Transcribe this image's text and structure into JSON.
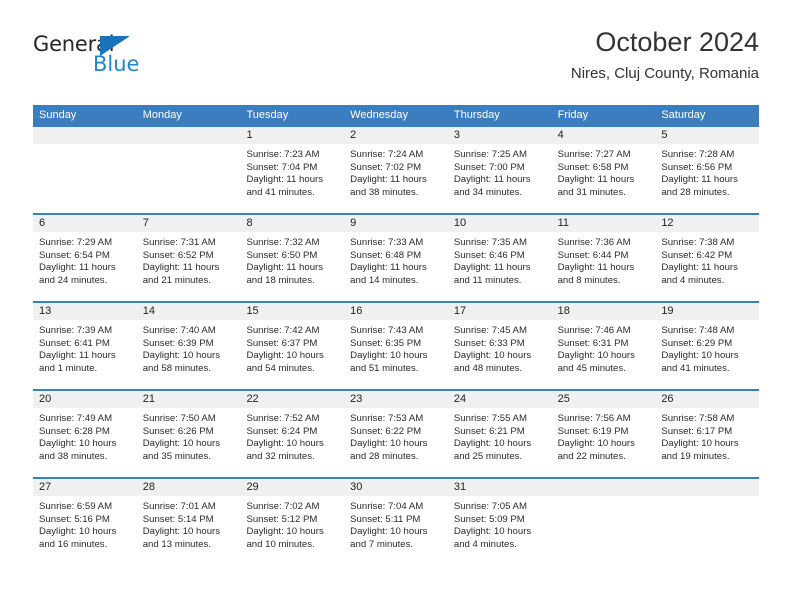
{
  "brand": {
    "name_top": "General",
    "name_bottom": "Blue",
    "triangle_color": "#1b74bb",
    "blue_color": "#2585c9"
  },
  "header": {
    "title": "October 2024",
    "subtitle": "Nires, Cluj County, Romania"
  },
  "theme": {
    "header_band": "#3b7ebf",
    "daynum_band": "#f0f0f0",
    "text": "#2b2b2b"
  },
  "weekday_labels": [
    "Sunday",
    "Monday",
    "Tuesday",
    "Wednesday",
    "Thursday",
    "Friday",
    "Saturday"
  ],
  "weeks": [
    [
      {
        "day": "",
        "sunrise": "",
        "sunset": "",
        "daylight_line1": "",
        "daylight_line2": ""
      },
      {
        "day": "",
        "sunrise": "",
        "sunset": "",
        "daylight_line1": "",
        "daylight_line2": ""
      },
      {
        "day": "1",
        "sunrise": "Sunrise: 7:23 AM",
        "sunset": "Sunset: 7:04 PM",
        "daylight_line1": "Daylight: 11 hours",
        "daylight_line2": "and 41 minutes."
      },
      {
        "day": "2",
        "sunrise": "Sunrise: 7:24 AM",
        "sunset": "Sunset: 7:02 PM",
        "daylight_line1": "Daylight: 11 hours",
        "daylight_line2": "and 38 minutes."
      },
      {
        "day": "3",
        "sunrise": "Sunrise: 7:25 AM",
        "sunset": "Sunset: 7:00 PM",
        "daylight_line1": "Daylight: 11 hours",
        "daylight_line2": "and 34 minutes."
      },
      {
        "day": "4",
        "sunrise": "Sunrise: 7:27 AM",
        "sunset": "Sunset: 6:58 PM",
        "daylight_line1": "Daylight: 11 hours",
        "daylight_line2": "and 31 minutes."
      },
      {
        "day": "5",
        "sunrise": "Sunrise: 7:28 AM",
        "sunset": "Sunset: 6:56 PM",
        "daylight_line1": "Daylight: 11 hours",
        "daylight_line2": "and 28 minutes."
      }
    ],
    [
      {
        "day": "6",
        "sunrise": "Sunrise: 7:29 AM",
        "sunset": "Sunset: 6:54 PM",
        "daylight_line1": "Daylight: 11 hours",
        "daylight_line2": "and 24 minutes."
      },
      {
        "day": "7",
        "sunrise": "Sunrise: 7:31 AM",
        "sunset": "Sunset: 6:52 PM",
        "daylight_line1": "Daylight: 11 hours",
        "daylight_line2": "and 21 minutes."
      },
      {
        "day": "8",
        "sunrise": "Sunrise: 7:32 AM",
        "sunset": "Sunset: 6:50 PM",
        "daylight_line1": "Daylight: 11 hours",
        "daylight_line2": "and 18 minutes."
      },
      {
        "day": "9",
        "sunrise": "Sunrise: 7:33 AM",
        "sunset": "Sunset: 6:48 PM",
        "daylight_line1": "Daylight: 11 hours",
        "daylight_line2": "and 14 minutes."
      },
      {
        "day": "10",
        "sunrise": "Sunrise: 7:35 AM",
        "sunset": "Sunset: 6:46 PM",
        "daylight_line1": "Daylight: 11 hours",
        "daylight_line2": "and 11 minutes."
      },
      {
        "day": "11",
        "sunrise": "Sunrise: 7:36 AM",
        "sunset": "Sunset: 6:44 PM",
        "daylight_line1": "Daylight: 11 hours",
        "daylight_line2": "and 8 minutes."
      },
      {
        "day": "12",
        "sunrise": "Sunrise: 7:38 AM",
        "sunset": "Sunset: 6:42 PM",
        "daylight_line1": "Daylight: 11 hours",
        "daylight_line2": "and 4 minutes."
      }
    ],
    [
      {
        "day": "13",
        "sunrise": "Sunrise: 7:39 AM",
        "sunset": "Sunset: 6:41 PM",
        "daylight_line1": "Daylight: 11 hours",
        "daylight_line2": "and 1 minute."
      },
      {
        "day": "14",
        "sunrise": "Sunrise: 7:40 AM",
        "sunset": "Sunset: 6:39 PM",
        "daylight_line1": "Daylight: 10 hours",
        "daylight_line2": "and 58 minutes."
      },
      {
        "day": "15",
        "sunrise": "Sunrise: 7:42 AM",
        "sunset": "Sunset: 6:37 PM",
        "daylight_line1": "Daylight: 10 hours",
        "daylight_line2": "and 54 minutes."
      },
      {
        "day": "16",
        "sunrise": "Sunrise: 7:43 AM",
        "sunset": "Sunset: 6:35 PM",
        "daylight_line1": "Daylight: 10 hours",
        "daylight_line2": "and 51 minutes."
      },
      {
        "day": "17",
        "sunrise": "Sunrise: 7:45 AM",
        "sunset": "Sunset: 6:33 PM",
        "daylight_line1": "Daylight: 10 hours",
        "daylight_line2": "and 48 minutes."
      },
      {
        "day": "18",
        "sunrise": "Sunrise: 7:46 AM",
        "sunset": "Sunset: 6:31 PM",
        "daylight_line1": "Daylight: 10 hours",
        "daylight_line2": "and 45 minutes."
      },
      {
        "day": "19",
        "sunrise": "Sunrise: 7:48 AM",
        "sunset": "Sunset: 6:29 PM",
        "daylight_line1": "Daylight: 10 hours",
        "daylight_line2": "and 41 minutes."
      }
    ],
    [
      {
        "day": "20",
        "sunrise": "Sunrise: 7:49 AM",
        "sunset": "Sunset: 6:28 PM",
        "daylight_line1": "Daylight: 10 hours",
        "daylight_line2": "and 38 minutes."
      },
      {
        "day": "21",
        "sunrise": "Sunrise: 7:50 AM",
        "sunset": "Sunset: 6:26 PM",
        "daylight_line1": "Daylight: 10 hours",
        "daylight_line2": "and 35 minutes."
      },
      {
        "day": "22",
        "sunrise": "Sunrise: 7:52 AM",
        "sunset": "Sunset: 6:24 PM",
        "daylight_line1": "Daylight: 10 hours",
        "daylight_line2": "and 32 minutes."
      },
      {
        "day": "23",
        "sunrise": "Sunrise: 7:53 AM",
        "sunset": "Sunset: 6:22 PM",
        "daylight_line1": "Daylight: 10 hours",
        "daylight_line2": "and 28 minutes."
      },
      {
        "day": "24",
        "sunrise": "Sunrise: 7:55 AM",
        "sunset": "Sunset: 6:21 PM",
        "daylight_line1": "Daylight: 10 hours",
        "daylight_line2": "and 25 minutes."
      },
      {
        "day": "25",
        "sunrise": "Sunrise: 7:56 AM",
        "sunset": "Sunset: 6:19 PM",
        "daylight_line1": "Daylight: 10 hours",
        "daylight_line2": "and 22 minutes."
      },
      {
        "day": "26",
        "sunrise": "Sunrise: 7:58 AM",
        "sunset": "Sunset: 6:17 PM",
        "daylight_line1": "Daylight: 10 hours",
        "daylight_line2": "and 19 minutes."
      }
    ],
    [
      {
        "day": "27",
        "sunrise": "Sunrise: 6:59 AM",
        "sunset": "Sunset: 5:16 PM",
        "daylight_line1": "Daylight: 10 hours",
        "daylight_line2": "and 16 minutes."
      },
      {
        "day": "28",
        "sunrise": "Sunrise: 7:01 AM",
        "sunset": "Sunset: 5:14 PM",
        "daylight_line1": "Daylight: 10 hours",
        "daylight_line2": "and 13 minutes."
      },
      {
        "day": "29",
        "sunrise": "Sunrise: 7:02 AM",
        "sunset": "Sunset: 5:12 PM",
        "daylight_line1": "Daylight: 10 hours",
        "daylight_line2": "and 10 minutes."
      },
      {
        "day": "30",
        "sunrise": "Sunrise: 7:04 AM",
        "sunset": "Sunset: 5:11 PM",
        "daylight_line1": "Daylight: 10 hours",
        "daylight_line2": "and 7 minutes."
      },
      {
        "day": "31",
        "sunrise": "Sunrise: 7:05 AM",
        "sunset": "Sunset: 5:09 PM",
        "daylight_line1": "Daylight: 10 hours",
        "daylight_line2": "and 4 minutes."
      },
      {
        "day": "",
        "sunrise": "",
        "sunset": "",
        "daylight_line1": "",
        "daylight_line2": ""
      },
      {
        "day": "",
        "sunrise": "",
        "sunset": "",
        "daylight_line1": "",
        "daylight_line2": ""
      }
    ]
  ]
}
